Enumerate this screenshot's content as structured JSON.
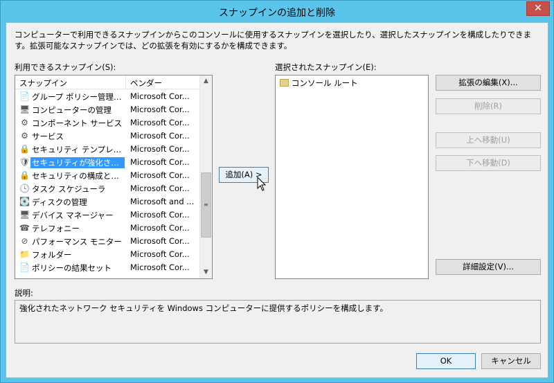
{
  "window": {
    "title": "スナップインの追加と削除",
    "close_label": "✕"
  },
  "description_top": "コンピューターで利用できるスナップインからこのコンソールに使用するスナップインを選択したり、選択したスナップインを構成したりできます。拡張可能なスナップインでは、どの拡張を有効にするかを構成できます。",
  "available": {
    "label": "利用できるスナップイン(S):",
    "col_snapin": "スナップイン",
    "col_vendor": "ベンダー",
    "rows": [
      {
        "name": "グループ ポリシー管理エディ...",
        "vendor": "Microsoft Cor...",
        "icon": "policy-icon",
        "glyph": "📄"
      },
      {
        "name": "コンピューターの管理",
        "vendor": "Microsoft Cor...",
        "icon": "computer-management-icon",
        "glyph": "🖥"
      },
      {
        "name": "コンポーネント サービス",
        "vendor": "Microsoft Cor...",
        "icon": "component-services-icon",
        "glyph": "⚙"
      },
      {
        "name": "サービス",
        "vendor": "Microsoft Cor...",
        "icon": "services-icon",
        "glyph": "⚙"
      },
      {
        "name": "セキュリティ テンプレート",
        "vendor": "Microsoft Cor...",
        "icon": "security-template-icon",
        "glyph": "🔒"
      },
      {
        "name": "セキュリティが強化された ...",
        "vendor": "Microsoft Cor...",
        "icon": "firewall-icon",
        "glyph": "🛡",
        "selected": true
      },
      {
        "name": "セキュリティの構成と分析",
        "vendor": "Microsoft Cor...",
        "icon": "security-analysis-icon",
        "glyph": "🔒"
      },
      {
        "name": "タスク スケジューラ",
        "vendor": "Microsoft Cor...",
        "icon": "task-scheduler-icon",
        "glyph": "🕓"
      },
      {
        "name": "ディスクの管理",
        "vendor": "Microsoft and ...",
        "icon": "disk-management-icon",
        "glyph": "💽"
      },
      {
        "name": "デバイス マネージャー",
        "vendor": "Microsoft Cor...",
        "icon": "device-manager-icon",
        "glyph": "🖥"
      },
      {
        "name": "テレフォニー",
        "vendor": "Microsoft Cor...",
        "icon": "telephony-icon",
        "glyph": "☎"
      },
      {
        "name": "パフォーマンス モニター",
        "vendor": "Microsoft Cor...",
        "icon": "performance-monitor-icon",
        "glyph": "⊘"
      },
      {
        "name": "フォルダー",
        "vendor": "Microsoft Cor...",
        "icon": "folder-icon",
        "glyph": "📁"
      },
      {
        "name": "ポリシーの結果セット",
        "vendor": "Microsoft Cor...",
        "icon": "rsop-icon",
        "glyph": "📄"
      }
    ]
  },
  "add_button": "追加(A) >",
  "selected": {
    "label": "選択されたスナップイン(E):",
    "items": [
      {
        "name": "コンソール ルート",
        "icon": "folder-icon"
      }
    ]
  },
  "buttons": {
    "edit_extensions": "拡張の編集(X)...",
    "remove": "削除(R)",
    "move_up": "上へ移動(U)",
    "move_down": "下へ移動(D)",
    "advanced": "詳細設定(V)...",
    "ok": "OK",
    "cancel": "キャンセル"
  },
  "description": {
    "label": "説明:",
    "text": "強化されたネットワーク セキュリティを Windows コンピューターに提供するポリシーを構成します。"
  },
  "colors": {
    "title_bar": "#5bc4ea",
    "selection": "#3399ff",
    "close_button": "#c7504b"
  }
}
